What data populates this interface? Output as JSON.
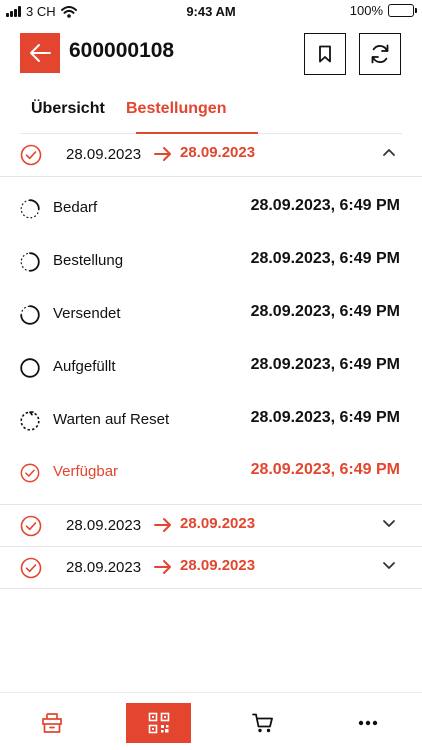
{
  "status_bar": {
    "carrier": "3 CH",
    "time": "9:43 AM",
    "battery": "100%",
    "battery_level": 1.0
  },
  "header": {
    "title": "600000108",
    "back_icon": "arrow-left-icon",
    "bookmark_icon": "bookmark-icon",
    "refresh_icon": "refresh-icon"
  },
  "tabs": [
    {
      "label": "Übersicht",
      "active": false
    },
    {
      "label": "Bestellungen",
      "active": true
    }
  ],
  "orders": [
    {
      "start": "28.09.2023",
      "end": "28.09.2023",
      "expanded": true,
      "steps": [
        {
          "label": "Bedarf",
          "timestamp": "28.09.2023, 6:49 PM",
          "icon": "progress-quarter-icon"
        },
        {
          "label": "Bestellung",
          "timestamp": "28.09.2023, 6:49 PM",
          "icon": "progress-half-icon"
        },
        {
          "label": "Versendet",
          "timestamp": "28.09.2023, 6:49 PM",
          "icon": "progress-three-quarter-icon"
        },
        {
          "label": "Aufgefüllt",
          "timestamp": "28.09.2023, 6:49 PM",
          "icon": "circle-full-icon"
        },
        {
          "label": "Warten auf Reset",
          "timestamp": "28.09.2023, 6:49 PM",
          "icon": "dashed-reset-icon"
        },
        {
          "label": "Verfügbar",
          "timestamp": "28.09.2023, 6:49 PM",
          "icon": "check-circle-icon"
        }
      ]
    },
    {
      "start": "28.09.2023",
      "end": "28.09.2023",
      "expanded": false
    },
    {
      "start": "28.09.2023",
      "end": "28.09.2023",
      "expanded": false
    }
  ],
  "bottom_nav": [
    {
      "icon": "box-icon"
    },
    {
      "icon": "qr-code-icon",
      "active": true
    },
    {
      "icon": "cart-icon"
    },
    {
      "icon": "more-icon"
    }
  ],
  "colors": {
    "accent": "#e3452e",
    "text": "#111111",
    "divider": "#e6e6e6"
  }
}
